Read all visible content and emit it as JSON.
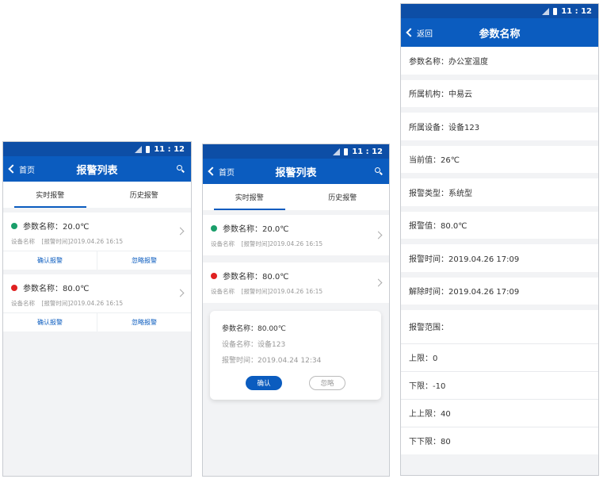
{
  "status": {
    "time": "11 : 12"
  },
  "screen1": {
    "back": "首页",
    "title": "报警列表",
    "tabs": [
      "实时报警",
      "历史报警"
    ],
    "alarms": [
      {
        "param": "参数名称：20.0℃",
        "device": "设备名称",
        "time": "[报警时间]2019.04.26 16:15",
        "confirm": "确认报警",
        "ignore": "忽略报警",
        "color": "#1a9e6a"
      },
      {
        "param": "参数名称：80.0℃",
        "device": "设备名称",
        "time": "[报警时间]2019.04.26 16:15",
        "confirm": "确认报警",
        "ignore": "忽略报警",
        "color": "#e02121"
      }
    ]
  },
  "screen2": {
    "back": "首页",
    "title": "报警列表",
    "tabs": [
      "实时报警",
      "历史报警"
    ],
    "alarms": [
      {
        "param": "参数名称：20.0℃",
        "device": "设备名称",
        "time": "[报警时间]2019.04.26 16:15"
      },
      {
        "param": "参数名称：80.0℃",
        "device": "设备名称",
        "time": "[报警时间]2019.04.26 16:15"
      }
    ],
    "dialog": {
      "param": "参数名称：80.00℃",
      "device": "设备名称：设备123",
      "time": "报警时间：2019.04.24 12:34",
      "confirm": "确认",
      "ignore": "忽略"
    }
  },
  "screen3": {
    "back": "返回",
    "title": "参数名称",
    "rows": [
      "参数名称：办公室温度",
      "所属机构：中易云",
      "所属设备：设备123",
      "当前值：26℃",
      "报警类型：系统型",
      "报警值：80.0℃",
      "报警时间：2019.04.26 17:09",
      "解除时间：2019.04.26 17:09"
    ],
    "range_title": "报警范围：",
    "limits": [
      "上限：0",
      "下限：-10",
      "上上限：40",
      "下下限：80"
    ]
  }
}
